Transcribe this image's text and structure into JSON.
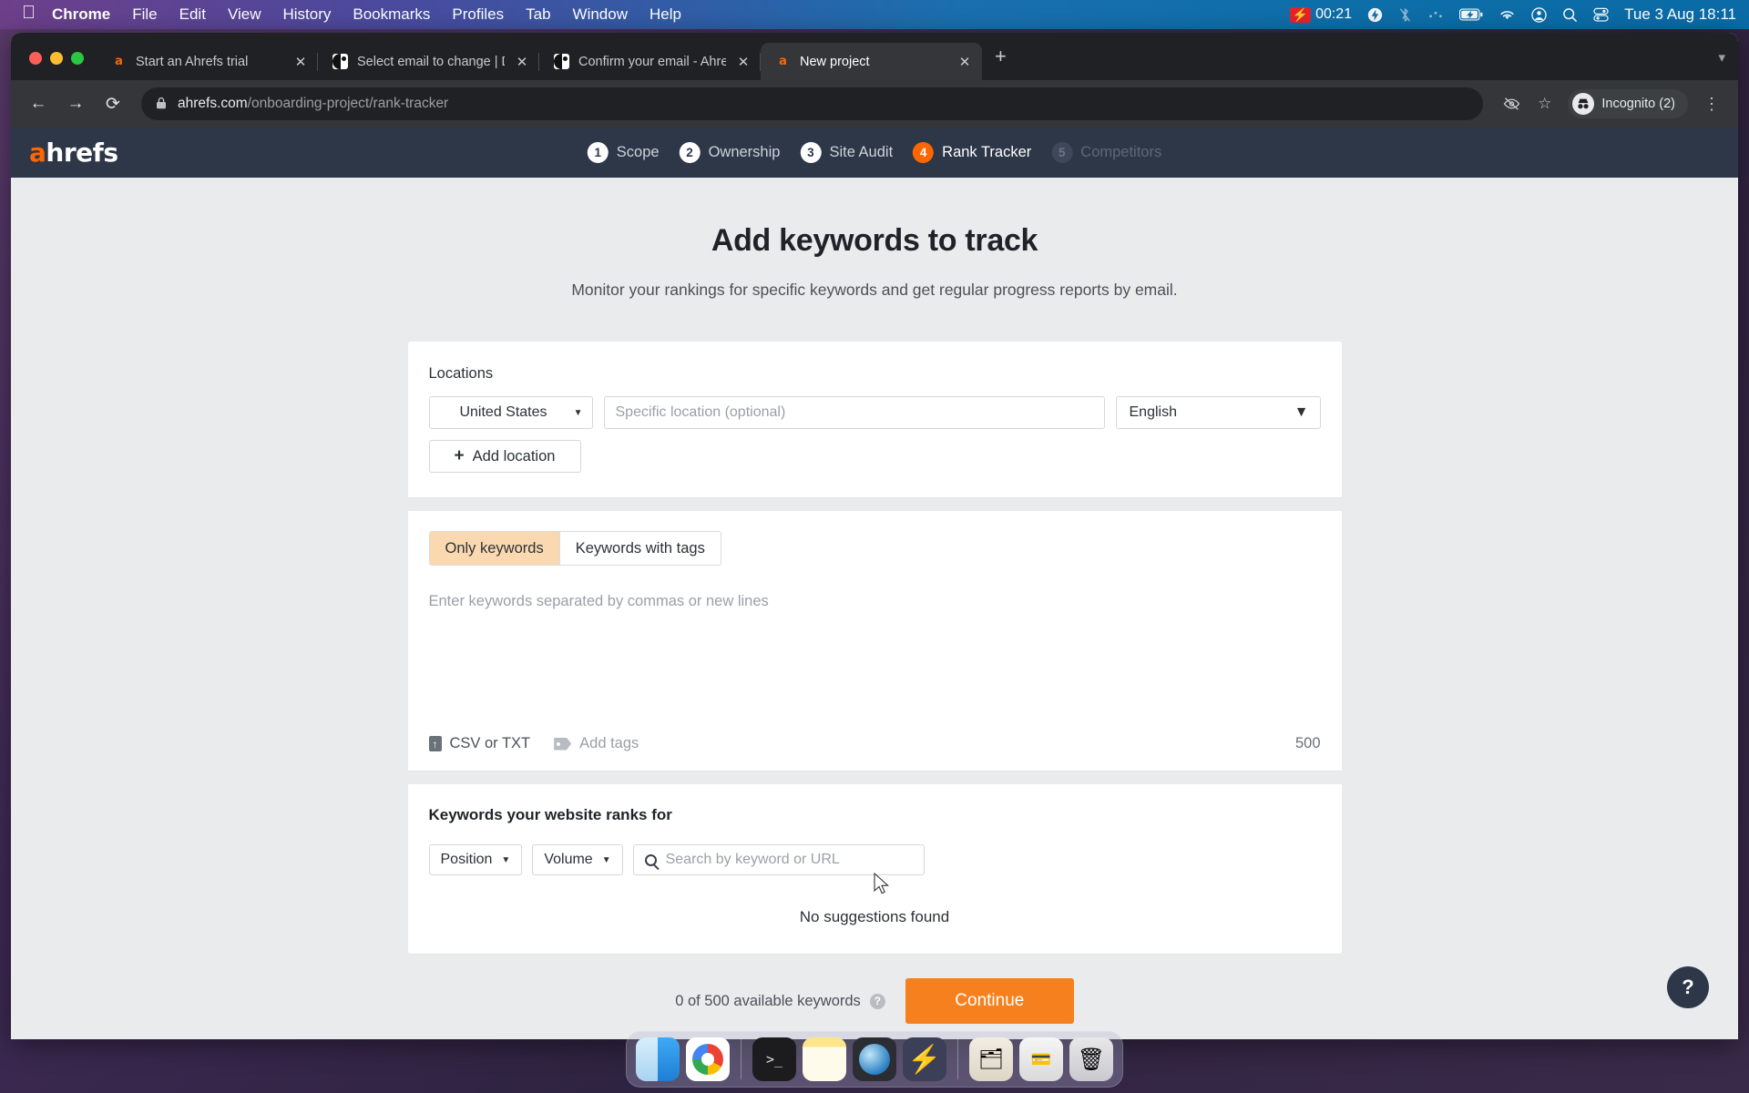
{
  "menubar": {
    "apple": "",
    "items": [
      "Chrome",
      "File",
      "Edit",
      "View",
      "History",
      "Bookmarks",
      "Profiles",
      "Tab",
      "Window",
      "Help"
    ],
    "timer": "00:21",
    "clock": "Tue 3 Aug  18:11",
    "status_icons": [
      "bolt-icon",
      "bluetooth-off-icon",
      "dots-icon",
      "battery-charging-icon",
      "wifi-icon",
      "user-account-icon",
      "spotlight-search-icon",
      "control-center-icon"
    ]
  },
  "browser": {
    "tabs": [
      {
        "title": "Start an Ahrefs trial",
        "favicon": "ahrefs-icon",
        "close": "✕",
        "active": false
      },
      {
        "title": "Select email to change | Djang",
        "favicon": "django-icon",
        "close": "✕",
        "active": false
      },
      {
        "title": "Confirm your email - Ahrefs",
        "favicon": "django-icon",
        "close": "✕",
        "active": false
      },
      {
        "title": "New project",
        "favicon": "ahrefs-icon",
        "close": "✕",
        "active": true
      }
    ],
    "new_tab_label": "+",
    "tabstrip_overflow": "▾",
    "nav": {
      "back": "←",
      "forward": "→",
      "reload": "⟳"
    },
    "omnibox": {
      "lock": "lock-icon",
      "url_domain": "ahrefs.com",
      "url_path": "/onboarding-project/rank-tracker"
    },
    "toolbar_icons": {
      "hidden_eye": "eye-slash-icon",
      "bookmark": "☆",
      "menu": "⋮"
    },
    "profile": {
      "label": "Incognito (2)",
      "avatar": "incognito-hat-icon"
    }
  },
  "site": {
    "logo": {
      "a": "a",
      "rest": "hrefs"
    },
    "steps": [
      {
        "num": "1",
        "label": "Scope",
        "state": "done"
      },
      {
        "num": "2",
        "label": "Ownership",
        "state": "done"
      },
      {
        "num": "3",
        "label": "Site Audit",
        "state": "done"
      },
      {
        "num": "4",
        "label": "Rank Tracker",
        "state": "active"
      },
      {
        "num": "5",
        "label": "Competitors",
        "state": "disabled"
      }
    ],
    "accent_color": "#f60",
    "header_color": "#2d3748"
  },
  "main": {
    "title": "Add keywords to track",
    "subtitle": "Monitor your rankings for specific keywords and get regular progress reports by email.",
    "locations": {
      "label": "Locations",
      "country_value": "United States",
      "country_caret": "▼",
      "specific_placeholder": "Specific location (optional)",
      "specific_value": "",
      "language_value": "English",
      "language_caret": "▼",
      "add_location_label": "Add location",
      "add_location_plus": "+"
    },
    "keywords": {
      "tabs": [
        {
          "label": "Only keywords",
          "selected": true
        },
        {
          "label": "Keywords with tags",
          "selected": false
        }
      ],
      "textarea_placeholder": "Enter keywords separated by commas or new lines",
      "textarea_value": "",
      "csv_label": "CSV or TXT",
      "add_tags_label": "Add tags",
      "remaining_count": "500"
    },
    "ranks": {
      "title": "Keywords your website ranks for",
      "position_label": "Position",
      "position_caret": "▼",
      "volume_label": "Volume",
      "volume_caret": "▼",
      "search_placeholder": "Search by keyword or URL",
      "search_value": "",
      "empty_message": "No suggestions found"
    },
    "footer": {
      "available_text": "0 of 500 available keywords",
      "help_tooltip": "?",
      "continue_label": "Continue",
      "continue_color": "#f7801e"
    },
    "help_fab": "?"
  },
  "dock": {
    "apps": [
      {
        "name": "finder",
        "glyph": ""
      },
      {
        "name": "chrome",
        "glyph": ""
      },
      {
        "name": "terminal",
        "glyph": ">_"
      },
      {
        "name": "notes",
        "glyph": ""
      },
      {
        "name": "preview",
        "glyph": ""
      },
      {
        "name": "lightning-app",
        "glyph": "⚡"
      },
      {
        "name": "documents-stack",
        "glyph": "🗂"
      },
      {
        "name": "card-reader",
        "glyph": "💳"
      },
      {
        "name": "trash",
        "glyph": "🗑"
      }
    ]
  }
}
